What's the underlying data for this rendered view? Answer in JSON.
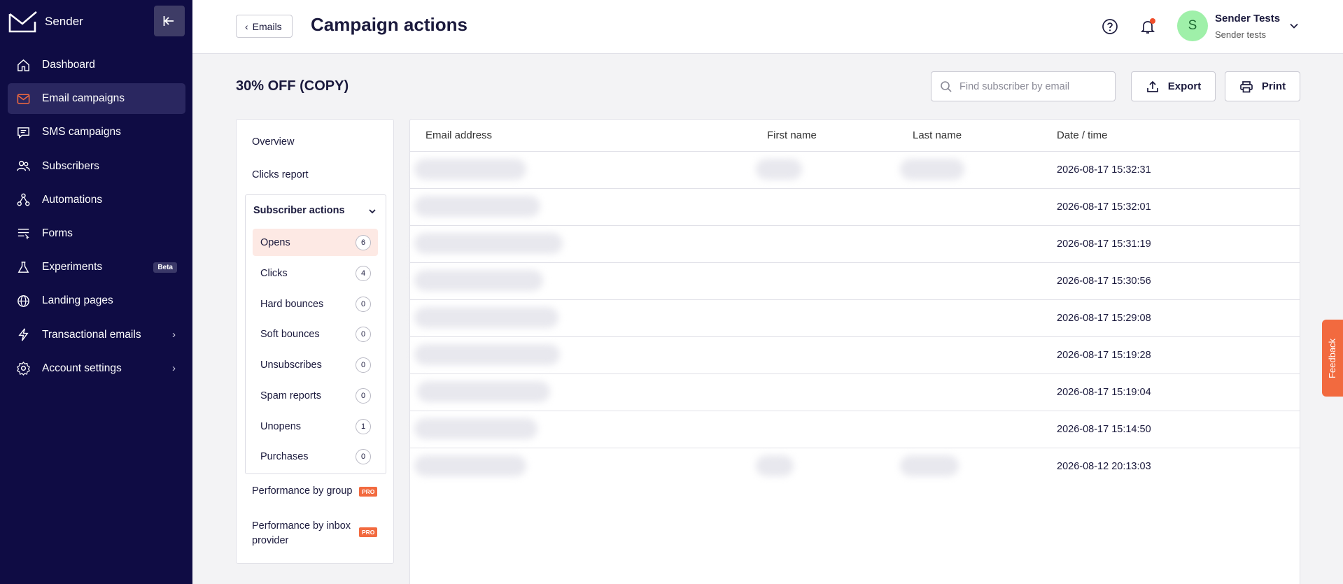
{
  "brand": {
    "name": "Sender"
  },
  "sidebar": {
    "items": [
      {
        "label": "Dashboard",
        "icon": "home-icon"
      },
      {
        "label": "Email campaigns",
        "icon": "mail-icon",
        "active": true
      },
      {
        "label": "SMS campaigns",
        "icon": "chat-icon"
      },
      {
        "label": "Subscribers",
        "icon": "users-icon"
      },
      {
        "label": "Automations",
        "icon": "automation-icon"
      },
      {
        "label": "Forms",
        "icon": "form-icon"
      },
      {
        "label": "Experiments",
        "icon": "flask-icon",
        "badge": "Beta"
      },
      {
        "label": "Landing pages",
        "icon": "globe-icon"
      },
      {
        "label": "Transactional emails",
        "icon": "bolt-icon",
        "chevron": true
      },
      {
        "label": "Account settings",
        "icon": "gear-icon",
        "chevron": true
      }
    ]
  },
  "header": {
    "back_label": "Emails",
    "title": "Campaign actions",
    "user": {
      "initial": "S",
      "name": "Sender Tests",
      "account": "Sender tests"
    }
  },
  "main": {
    "campaign_name": "30% OFF (COPY)",
    "search_placeholder": "Find subscriber by email",
    "export_label": "Export",
    "print_label": "Print"
  },
  "report_nav": {
    "overview": "Overview",
    "clicks_report": "Clicks report",
    "subscriber_actions": {
      "label": "Subscriber actions",
      "items": [
        {
          "label": "Opens",
          "count": "6",
          "active": true
        },
        {
          "label": "Clicks",
          "count": "4"
        },
        {
          "label": "Hard bounces",
          "count": "0"
        },
        {
          "label": "Soft bounces",
          "count": "0"
        },
        {
          "label": "Unsubscribes",
          "count": "0"
        },
        {
          "label": "Spam reports",
          "count": "0"
        },
        {
          "label": "Unopens",
          "count": "1"
        },
        {
          "label": "Purchases",
          "count": "0"
        }
      ]
    },
    "perf_group": "Performance by group",
    "perf_inbox": "Performance by inbox provider",
    "pro_badge": "PRO"
  },
  "table": {
    "columns": [
      "Email address",
      "First name",
      "Last name",
      "Date / time"
    ],
    "rows": [
      {
        "datetime": "2026-08-17 15:32:31"
      },
      {
        "datetime": "2026-08-17 15:32:01"
      },
      {
        "datetime": "2026-08-17 15:31:19"
      },
      {
        "datetime": "2026-08-17 15:30:56"
      },
      {
        "datetime": "2026-08-17 15:29:08"
      },
      {
        "datetime": "2026-08-17 15:19:28"
      },
      {
        "datetime": "2026-08-17 15:19:04"
      },
      {
        "datetime": "2026-08-17 15:14:50"
      },
      {
        "datetime": "2026-08-12 20:13:03"
      }
    ]
  },
  "feedback_label": "Feedback",
  "colors": {
    "sidebar": "#0f0c44",
    "accent": "#f26a3f",
    "active_row": "#fde9e4"
  }
}
